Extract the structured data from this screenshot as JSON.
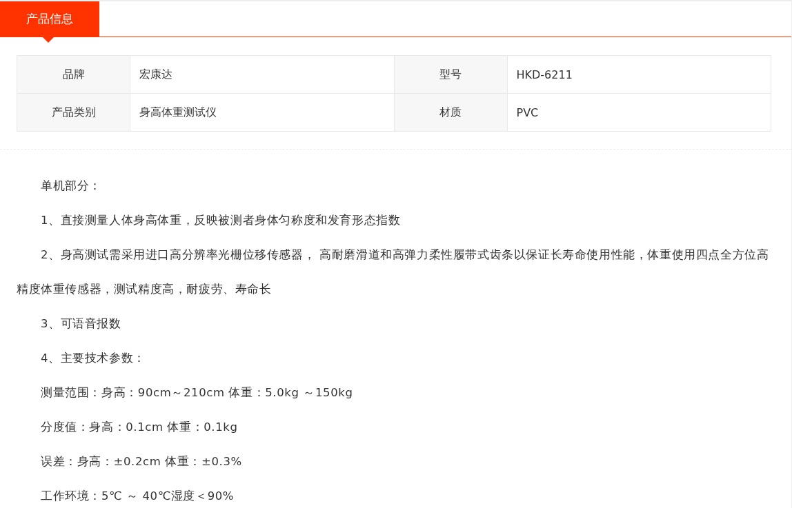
{
  "tabs": [
    {
      "label": "产品信息",
      "selected": true
    }
  ],
  "specs": [
    [
      {
        "label": "品牌",
        "value": "宏康达"
      },
      {
        "label": "型号",
        "value": "HKD-6211"
      }
    ],
    [
      {
        "label": "产品类别",
        "value": "身高体重测试仪"
      },
      {
        "label": "材质",
        "value": "PVC"
      }
    ]
  ],
  "description": [
    "单机部分：",
    "1、直接测量人体身高体重，反映被测者身体匀称度和发育形态指数",
    "2、身高测试需采用进口高分辨率光栅位移传感器， 高耐磨滑道和高弹力柔性履带式齿条以保证长寿命使用性能，体重使用四点全方位高精度体重传感器，测试精度高，耐疲劳、寿命长",
    "3、可语音报数",
    "4、主要技术参数：",
    "测量范围：身高：90cm～210cm 体重：5.0kg ～150kg",
    "分度值：身高：0.1cm 体重：0.1kg",
    "误差：身高：±0.2cm 体重：±0.3%",
    "工作环境：5℃ ～ 40℃湿度＜90%"
  ]
}
